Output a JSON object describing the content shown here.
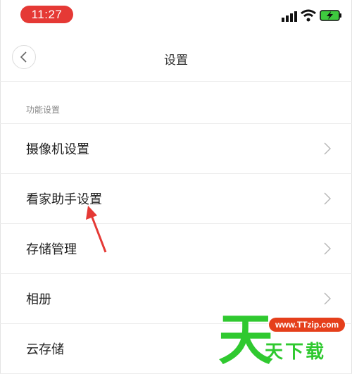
{
  "status_bar": {
    "time": "11:27",
    "time_pill_color": "#e53935",
    "battery_color": "#3ec93e",
    "icons": [
      "signal-icon",
      "wifi-icon",
      "battery-charging-icon"
    ]
  },
  "nav": {
    "title": "设置",
    "back_icon": "chevron-left-icon"
  },
  "section": {
    "label": "功能设置"
  },
  "items": [
    {
      "label": "摄像机设置"
    },
    {
      "label": "看家助手设置"
    },
    {
      "label": "存储管理"
    },
    {
      "label": "相册"
    },
    {
      "label": "云存储"
    }
  ],
  "annotation": {
    "arrow_color": "#e53935"
  },
  "watermark": {
    "big_char": "天",
    "url": "www.TTzip.com",
    "text": "天下载",
    "green": "#2fc92f",
    "red": "#e53f1b"
  }
}
